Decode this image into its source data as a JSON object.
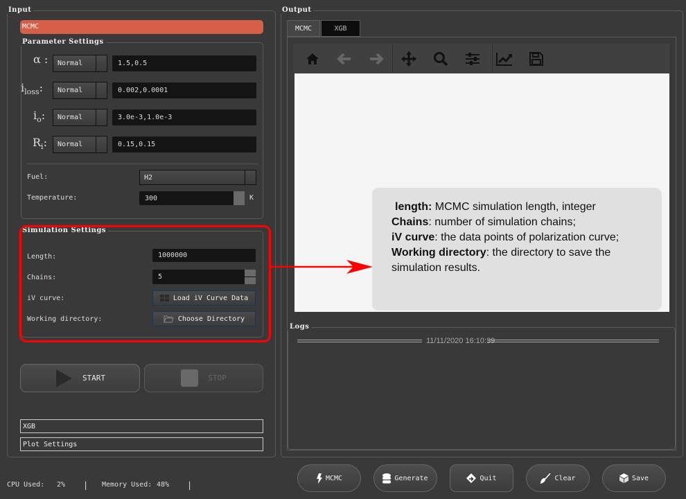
{
  "input": {
    "title": "Input",
    "mcmc_section": "MCMC",
    "parameter_settings": {
      "title": "Parameter Settings",
      "params": [
        {
          "symbol": "α",
          "sub": "",
          "distribution": "Normal",
          "value": "1.5,0.5"
        },
        {
          "symbol": "i",
          "sub": "loss",
          "distribution": "Normal",
          "value": "0.002,0.0001"
        },
        {
          "symbol": "i",
          "sub": "o",
          "distribution": "Normal",
          "value": "3.0e-3,1.0e-3"
        },
        {
          "symbol": "R",
          "sub": "i",
          "distribution": "Normal",
          "value": "0.15,0.15"
        }
      ],
      "fuel_label": "Fuel:",
      "fuel_value": "H2",
      "temperature_label": "Temperature:",
      "temperature_value": "300",
      "temperature_unit": "K"
    },
    "simulation_settings": {
      "title": "Simulation Settings",
      "length_label": "Length:",
      "length_value": "1000000",
      "chains_label": "Chains:",
      "chains_value": "5",
      "iv_label": "iV curve:",
      "iv_button": "Load iV Curve Data",
      "dir_label": "Working directory:",
      "dir_button": "Choose Directory"
    },
    "start_label": "START",
    "stop_label": "STOP",
    "xgb_section": "XGB",
    "plot_section": "Plot Settings"
  },
  "status": {
    "cpu_label": "CPU Used:",
    "cpu_value": "2%",
    "sep": "|",
    "mem_label": "Memory Used:",
    "mem_value": "48%"
  },
  "output": {
    "title": "Output",
    "tabs": [
      {
        "label": "MCMC",
        "active": true
      },
      {
        "label": "XGB",
        "active": false
      }
    ],
    "toolbar": [
      "home-icon",
      "back-icon",
      "forward-icon",
      "pan-icon",
      "zoom-icon",
      "configure-icon",
      "edit-curve-icon",
      "save-icon"
    ]
  },
  "tooltip": {
    "lines": [
      {
        "bold": "length:",
        "text": " MCMC simulation length, integer"
      },
      {
        "bold": "Chains",
        "text": ": number of simulation chains;"
      },
      {
        "bold": "iV curve",
        "text": ": the data points of polarization curve;"
      },
      {
        "bold": "Working directory",
        "text": ": the directory to save the simulation results."
      }
    ]
  },
  "logs": {
    "title": "Logs",
    "timestamp": "11/11/2020 16:10:39"
  },
  "actions": [
    {
      "label": "MCMC",
      "icon": "lightning-icon"
    },
    {
      "label": "Generate",
      "icon": "database-icon"
    },
    {
      "label": "Quit",
      "icon": "quit-icon"
    },
    {
      "label": "Clear",
      "icon": "brush-icon"
    },
    {
      "label": "Save",
      "icon": "box-icon"
    }
  ],
  "colors": {
    "accent": "#d65f47",
    "highlight": "#ff0000",
    "tooltip_bg": "#e0e0e0"
  }
}
